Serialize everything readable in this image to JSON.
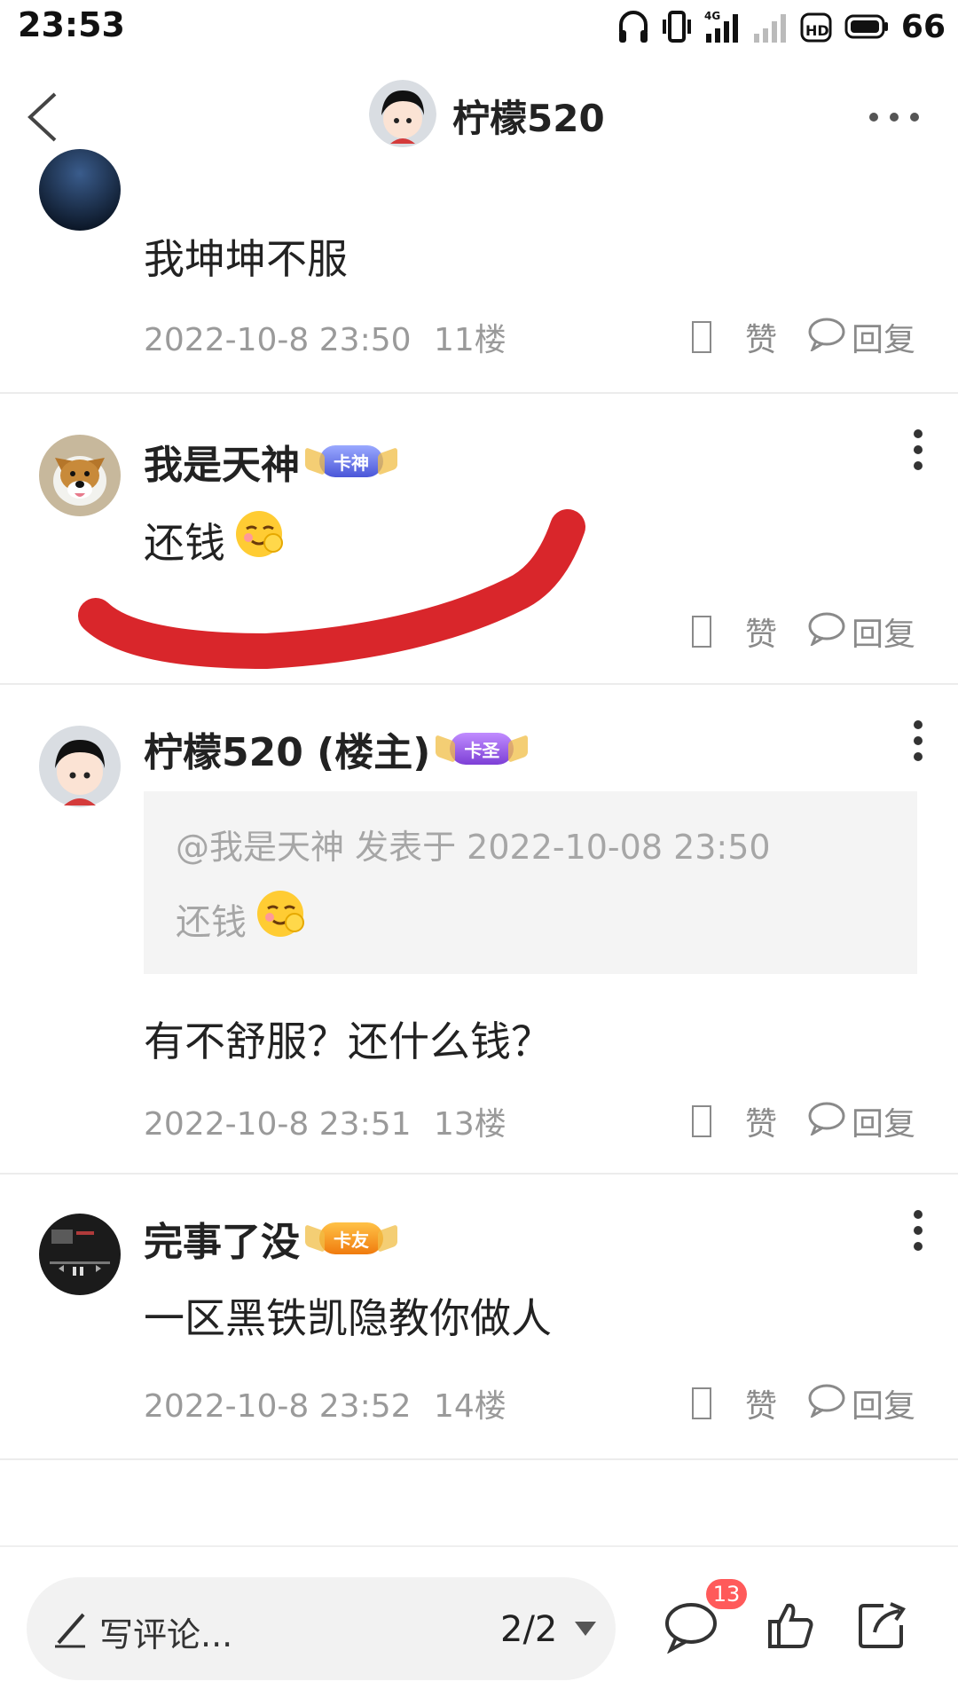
{
  "status_bar": {
    "time": "23:53",
    "battery": "66",
    "network": "4G"
  },
  "header": {
    "author_name": "柠檬520"
  },
  "comments": [
    {
      "text": "我坤坤不服",
      "timestamp": "2022-10-8 23:50",
      "floor": "11楼",
      "like_label": "赞",
      "reply_label": "回复"
    },
    {
      "username": "我是天神",
      "badge": "卡神",
      "text": "还钱",
      "like_label": "赞",
      "reply_label": "回复"
    },
    {
      "username": "柠檬520 (楼主)",
      "badge": "卡圣",
      "quote": {
        "header": "@我是天神 发表于 2022-10-08 23:50",
        "text": "还钱"
      },
      "text": "有不舒服？还什么钱？",
      "timestamp": "2022-10-8 23:51",
      "floor": "13楼",
      "like_label": "赞",
      "reply_label": "回复"
    },
    {
      "username": "完事了没",
      "badge": "卡友",
      "text": "一区黑铁凯隐教你做人",
      "timestamp": "2022-10-8 23:52",
      "floor": "14楼",
      "like_label": "赞",
      "reply_label": "回复"
    }
  ],
  "bottom_bar": {
    "input_placeholder": "写评论...",
    "page_indicator": "2/2",
    "comment_count": "13"
  },
  "colors": {
    "scribble": "#d9262b",
    "count_badge": "#ff5a5a",
    "meta_text": "#9a9a9a"
  }
}
